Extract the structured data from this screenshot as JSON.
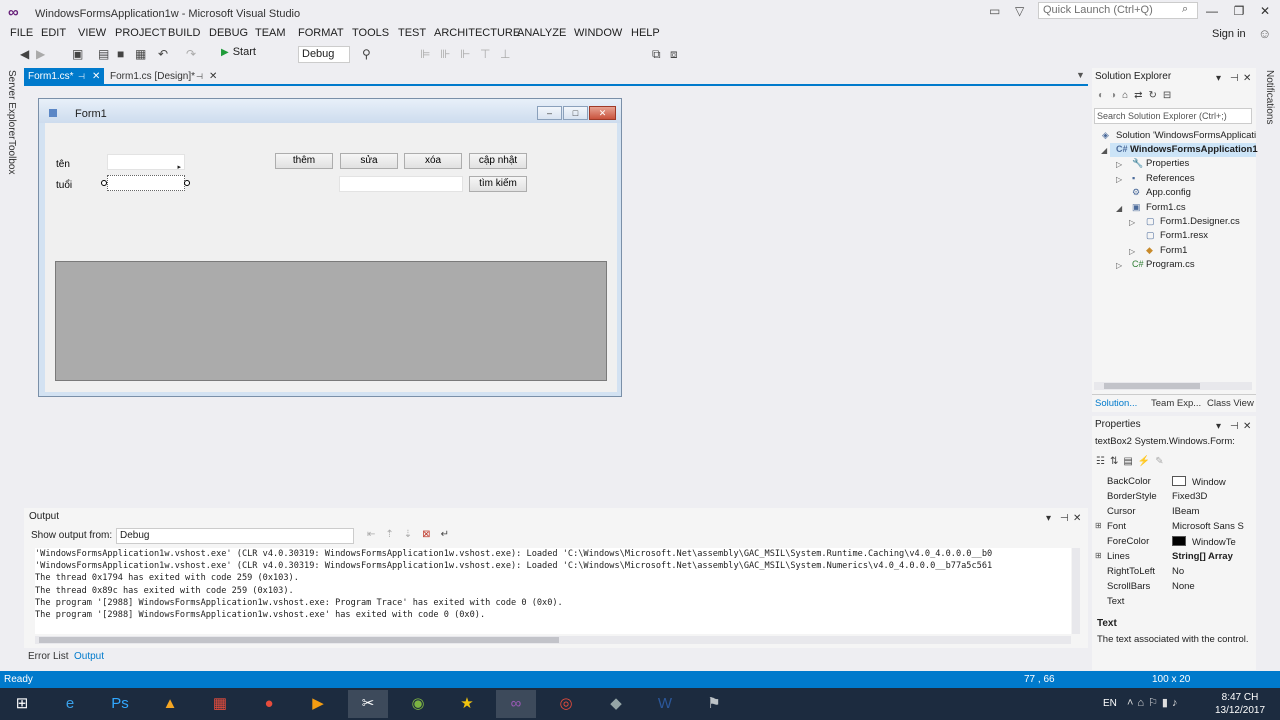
{
  "window": {
    "title": "WindowsFormsApplication1w - Microsoft Visual Studio",
    "quick_launch_placeholder": "Quick Launch (Ctrl+Q)",
    "sign_in": "Sign in"
  },
  "menu": [
    "FILE",
    "EDIT",
    "VIEW",
    "PROJECT",
    "BUILD",
    "DEBUG",
    "TEAM",
    "FORMAT",
    "TOOLS",
    "TEST",
    "ARCHITECTURE",
    "ANALYZE",
    "WINDOW",
    "HELP"
  ],
  "toolbar": {
    "start_label": "Start",
    "config": "Debug"
  },
  "left_strip": {
    "server_explorer": "Server Explorer",
    "toolbox": "Toolbox"
  },
  "right_strip": {
    "notifications": "Notifications"
  },
  "doc_tabs": [
    {
      "label": "Form1.cs*"
    },
    {
      "label": "Form1.cs [Design]*"
    }
  ],
  "form": {
    "title": "Form1",
    "labels": {
      "name": "tên",
      "age": "tuổi"
    },
    "buttons": {
      "add": "thêm",
      "edit": "sửa",
      "delete": "xóa",
      "update": "cập nhật",
      "search": "tìm kiếm"
    }
  },
  "solution_explorer": {
    "title": "Solution Explorer",
    "search_placeholder": "Search Solution Explorer (Ctrl+;)",
    "items": [
      {
        "label": "Solution 'WindowsFormsApplicati"
      },
      {
        "label": "WindowsFormsApplication1"
      },
      {
        "label": "Properties"
      },
      {
        "label": "References"
      },
      {
        "label": "App.config"
      },
      {
        "label": "Form1.cs"
      },
      {
        "label": "Form1.Designer.cs"
      },
      {
        "label": "Form1.resx"
      },
      {
        "label": "Form1"
      },
      {
        "label": "Program.cs"
      }
    ],
    "bottom_tabs": [
      "Solution...",
      "Team Exp...",
      "Class View"
    ]
  },
  "properties": {
    "title": "Properties",
    "selector": "textBox2  System.Windows.Form:",
    "rows": [
      {
        "name": "BackColor",
        "value": "Window",
        "swatch": "#ffffff"
      },
      {
        "name": "BorderStyle",
        "value": "Fixed3D"
      },
      {
        "name": "Cursor",
        "value": "IBeam"
      },
      {
        "name": "Font",
        "value": "Microsoft Sans S"
      },
      {
        "name": "ForeColor",
        "value": "WindowTe",
        "swatch": "#000000"
      },
      {
        "name": "Lines",
        "value": "String[] Array"
      },
      {
        "name": "RightToLeft",
        "value": "No"
      },
      {
        "name": "ScrollBars",
        "value": "None"
      },
      {
        "name": "Text",
        "value": ""
      }
    ],
    "desc_title": "Text",
    "desc": "The text associated with the control."
  },
  "output": {
    "title": "Output",
    "from_label": "Show output from:",
    "from_value": "Debug",
    "lines": [
      "'WindowsFormsApplication1w.vshost.exe' (CLR v4.0.30319: WindowsFormsApplication1w.vshost.exe): Loaded 'C:\\Windows\\Microsoft.Net\\assembly\\GAC_MSIL\\System.Runtime.Caching\\v4.0_4.0.0.0__b0",
      "'WindowsFormsApplication1w.vshost.exe' (CLR v4.0.30319: WindowsFormsApplication1w.vshost.exe): Loaded 'C:\\Windows\\Microsoft.Net\\assembly\\GAC_MSIL\\System.Numerics\\v4.0_4.0.0.0__b77a5c561",
      "The thread 0x1794 has exited with code 259 (0x103).",
      "The thread 0x89c has exited with code 259 (0x103).",
      "The program '[2988] WindowsFormsApplication1w.vshost.exe: Program Trace' has exited with code 0 (0x0).",
      "The program '[2988] WindowsFormsApplication1w.vshost.exe' has exited with code 0 (0x0)."
    ]
  },
  "bottom_tabs": [
    "Error List",
    "Output"
  ],
  "status": {
    "text": "Ready",
    "position": "77 , 66",
    "size": "100 x 20"
  },
  "taskbar": {
    "lang": "EN",
    "time": "8:47 CH",
    "date": "13/12/2017"
  },
  "colors": {
    "accent": "#007acc",
    "vs_purple": "#68217a"
  }
}
